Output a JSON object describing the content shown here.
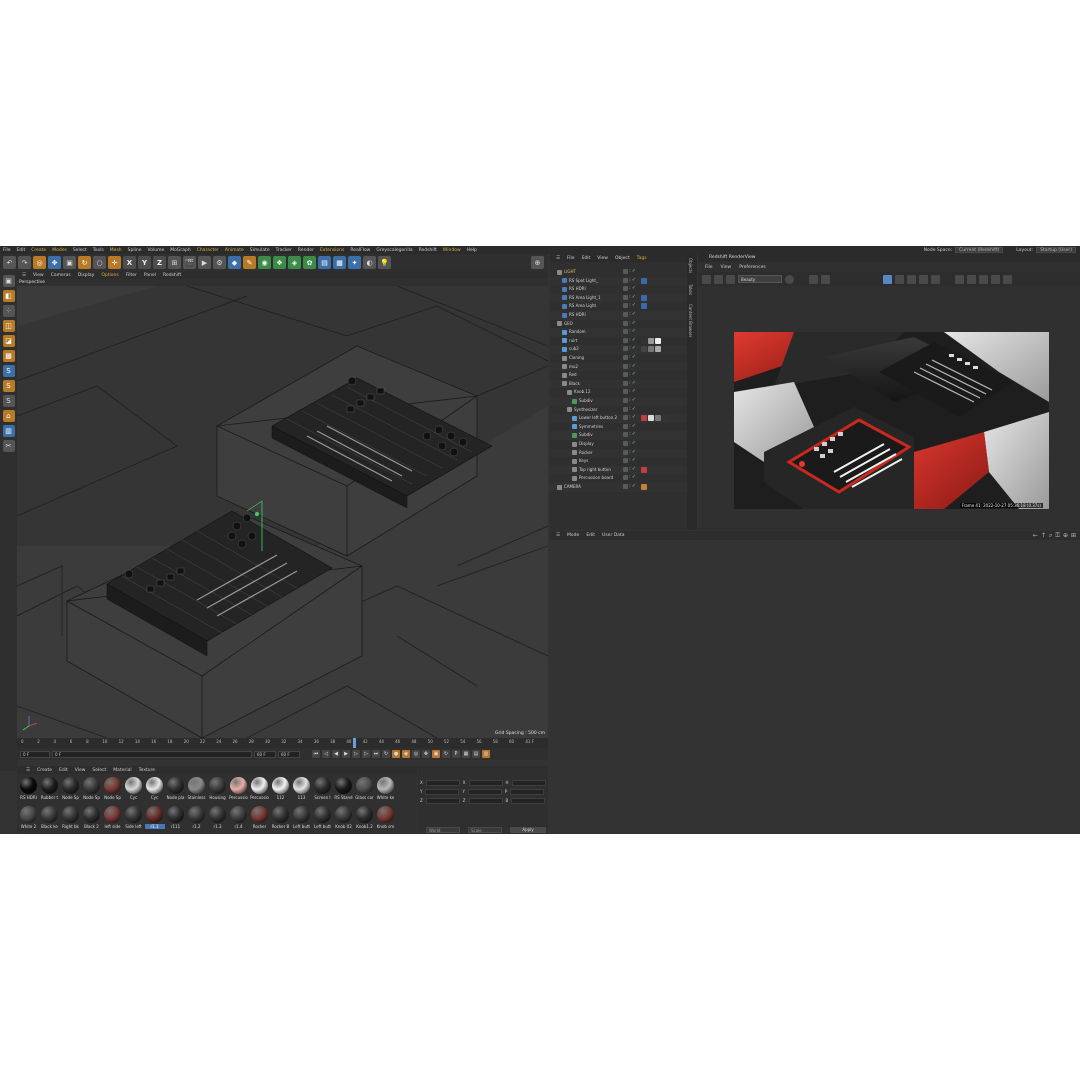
{
  "menubar": {
    "items": [
      {
        "label": "File",
        "hl": false
      },
      {
        "label": "Edit",
        "hl": false
      },
      {
        "label": "Create",
        "hl": true
      },
      {
        "label": "Modes",
        "hl": true
      },
      {
        "label": "Select",
        "hl": false
      },
      {
        "label": "Tools",
        "hl": false
      },
      {
        "label": "Mesh",
        "hl": true
      },
      {
        "label": "Spline",
        "hl": false
      },
      {
        "label": "Volume",
        "hl": false
      },
      {
        "label": "MoGraph",
        "hl": false
      },
      {
        "label": "Character",
        "hl": true
      },
      {
        "label": "Animate",
        "hl": true
      },
      {
        "label": "Simulate",
        "hl": false
      },
      {
        "label": "Tracker",
        "hl": false
      },
      {
        "label": "Render",
        "hl": false
      },
      {
        "label": "Extensions",
        "hl": true
      },
      {
        "label": "RealFlow",
        "hl": false
      },
      {
        "label": "Greyscalegorilla",
        "hl": false
      },
      {
        "label": "Redshift",
        "hl": false
      },
      {
        "label": "Window",
        "hl": true
      },
      {
        "label": "Help",
        "hl": false
      }
    ],
    "node_space_label": "Node Space:",
    "node_space_value": "Current (Redshift)",
    "layout_label": "Layout:",
    "layout_value": "Startup (User)"
  },
  "toolbar": {
    "axis_x": "X",
    "axis_y": "Y",
    "axis_z": "Z"
  },
  "viewport": {
    "menu": [
      {
        "label": "View",
        "sel": false
      },
      {
        "label": "Cameras",
        "sel": false
      },
      {
        "label": "Display",
        "sel": false
      },
      {
        "label": "Options",
        "sel": true
      },
      {
        "label": "Filter",
        "sel": false
      },
      {
        "label": "Panel",
        "sel": false
      },
      {
        "label": "Redshift",
        "sel": false
      }
    ],
    "camera_label": "Perspective",
    "grid_spacing": "Grid Spacing : 500 cm"
  },
  "timeline": {
    "ticks": [
      "0",
      "2",
      "4",
      "6",
      "8",
      "10",
      "12",
      "14",
      "16",
      "18",
      "20",
      "22",
      "24",
      "26",
      "28",
      "30",
      "32",
      "34",
      "36",
      "38",
      "40",
      "42",
      "44",
      "46",
      "48",
      "50",
      "52",
      "54",
      "56",
      "58",
      "60"
    ],
    "current_frame": "41 F",
    "playhead_frame": 41,
    "start_field": "0 F",
    "min_field": "0 F",
    "max_field": "60 F",
    "end_field": "60 F"
  },
  "material_manager": {
    "menu": [
      "Create",
      "Edit",
      "View",
      "Select",
      "Material",
      "Texture"
    ],
    "materials": [
      {
        "label": "RS HDRI",
        "color": "#0a0a0a",
        "sel": false
      },
      {
        "label": "Rubber t",
        "color": "#1e1e1e",
        "sel": false
      },
      {
        "label": "Node Sp",
        "color": "#2a2a2a",
        "sel": false
      },
      {
        "label": "Node Sp",
        "color": "#3a3a3a",
        "sel": false
      },
      {
        "label": "Node Sp",
        "color": "#7a3a32",
        "sel": false
      },
      {
        "label": "Cyc",
        "color": "#d8d8d8",
        "sel": false
      },
      {
        "label": "Cyc",
        "color": "#e8e8e8",
        "sel": false
      },
      {
        "label": "Node pla",
        "color": "#303030",
        "sel": false
      },
      {
        "label": "Stainless",
        "color": "#8a8a8a",
        "sel": false
      },
      {
        "label": "Housing",
        "color": "#3c3c3c",
        "sel": false
      },
      {
        "label": "Percussio",
        "color": "#e8b0a8",
        "sel": false
      },
      {
        "label": "Percussio",
        "color": "#f0f0f0",
        "sel": false
      },
      {
        "label": "112",
        "color": "#f4f4f4",
        "sel": false
      },
      {
        "label": "113",
        "color": "#e4e4e4",
        "sel": false
      },
      {
        "label": "Screen I",
        "color": "#2c2c2c",
        "sel": false
      },
      {
        "label": "RS Stand",
        "color": "#1a1a1a",
        "sel": false
      },
      {
        "label": "Glass cor",
        "color": "#505050",
        "sel": false
      },
      {
        "label": "White ke",
        "color": "#b8b8b8",
        "sel": false
      },
      {
        "label": "White 2",
        "color": "#4a4a4a",
        "sel": false
      },
      {
        "label": "Black ke",
        "color": "#3a3a3a",
        "sel": false
      },
      {
        "label": "Right bk",
        "color": "#363636",
        "sel": false
      },
      {
        "label": "Black 2",
        "color": "#303030",
        "sel": false
      },
      {
        "label": "left side",
        "color": "#7a3a32",
        "sel": false
      },
      {
        "label": "Side left",
        "color": "#343434",
        "sel": false
      },
      {
        "label": "r1.1",
        "color": "#6a2e2a",
        "sel": true
      },
      {
        "label": "r111",
        "color": "#2e2e2e",
        "sel": false
      },
      {
        "label": "r1.2",
        "color": "#3a3a3a",
        "sel": false
      },
      {
        "label": "r1.3",
        "color": "#343434",
        "sel": false
      },
      {
        "label": "r1.4",
        "color": "#3e3e3e",
        "sel": false
      },
      {
        "label": "Rocker",
        "color": "#7a3a32",
        "sel": false
      },
      {
        "label": "Rocker B",
        "color": "#333333",
        "sel": false
      },
      {
        "label": "Left butt",
        "color": "#3a3a3a",
        "sel": false
      },
      {
        "label": "Left butt",
        "color": "#333333",
        "sel": false
      },
      {
        "label": "Knob 02",
        "color": "#3a3a3a",
        "sel": false
      },
      {
        "label": "Knob1.2",
        "color": "#2e2e2e",
        "sel": false
      },
      {
        "label": "Knob sm",
        "color": "#7a3a32",
        "sel": false
      }
    ]
  },
  "coordinates": {
    "rows": [
      {
        "a": "X",
        "b": "X",
        "c": "H"
      },
      {
        "a": "Y",
        "b": "Y",
        "c": "P"
      },
      {
        "a": "Z",
        "b": "Z",
        "c": "B"
      }
    ],
    "dd1": "World",
    "dd2": "Scale",
    "apply": "Apply"
  },
  "object_manager": {
    "menu": [
      {
        "label": "File",
        "sel": false
      },
      {
        "label": "Edit",
        "sel": false
      },
      {
        "label": "View",
        "sel": false
      },
      {
        "label": "Object",
        "sel": false
      },
      {
        "label": "Tags",
        "sel": true
      }
    ],
    "objects": [
      {
        "name": "LIGHT",
        "indent": 0,
        "color": "#8a8a8a",
        "tags": [],
        "name_color": "#e8c060"
      },
      {
        "name": "RS Spot Light_",
        "indent": 1,
        "color": "#4a7ab8",
        "tags": [
          "#3a6aa8"
        ],
        "name_color": ""
      },
      {
        "name": "RS HDRI",
        "indent": 1,
        "color": "#4a7ab8",
        "tags": [],
        "name_color": ""
      },
      {
        "name": "RS Area Light_1",
        "indent": 1,
        "color": "#4a7ab8",
        "tags": [
          "#3a6aa8"
        ],
        "name_color": ""
      },
      {
        "name": "RS Area Light",
        "indent": 1,
        "color": "#4a7ab8",
        "tags": [
          "#3a6aa8"
        ],
        "name_color": ""
      },
      {
        "name": "RS HDRI",
        "indent": 1,
        "color": "#4a7ab8",
        "tags": [],
        "name_color": ""
      },
      {
        "name": "GEO",
        "indent": 0,
        "color": "#8a8a8a",
        "tags": [],
        "name_color": ""
      },
      {
        "name": "Random",
        "indent": 1,
        "color": "#5a9ad8",
        "tags": [],
        "name_color": ""
      },
      {
        "name": "ruirt",
        "indent": 1,
        "color": "#5a9ad8",
        "tags": [
          "#333",
          "#999",
          "#eee"
        ],
        "name_color": ""
      },
      {
        "name": "cub2",
        "indent": 1,
        "color": "#5a9ad8",
        "tags": [
          "#444",
          "#777",
          "#aaa"
        ],
        "name_color": ""
      },
      {
        "name": "Cloning",
        "indent": 1,
        "color": "#8a8a8a",
        "tags": [],
        "name_color": ""
      },
      {
        "name": "mu2",
        "indent": 1,
        "color": "#8a8a8a",
        "tags": [],
        "name_color": ""
      },
      {
        "name": "Red",
        "indent": 1,
        "color": "#8a8a8a",
        "tags": [],
        "name_color": ""
      },
      {
        "name": "Black",
        "indent": 1,
        "color": "#8a8a8a",
        "tags": [],
        "name_color": ""
      },
      {
        "name": "Knob.12",
        "indent": 2,
        "color": "#8a8a8a",
        "tags": [],
        "name_color": ""
      },
      {
        "name": "Subdiv",
        "indent": 3,
        "color": "#4a9a5a",
        "tags": [],
        "name_color": ""
      },
      {
        "name": "Synthesizer",
        "indent": 2,
        "color": "#8a8a8a",
        "tags": [],
        "name_color": ""
      },
      {
        "name": "Lower left button.2",
        "indent": 3,
        "color": "#5a9ad8",
        "tags": [
          "#c04040",
          "#ddd",
          "#777",
          "#333"
        ],
        "name_color": ""
      },
      {
        "name": "Symmetries",
        "indent": 3,
        "color": "#5a9ad8",
        "tags": [],
        "name_color": ""
      },
      {
        "name": "Subdiv",
        "indent": 3,
        "color": "#4a9a5a",
        "tags": [],
        "name_color": ""
      },
      {
        "name": "Display",
        "indent": 3,
        "color": "#8a8a8a",
        "tags": [],
        "name_color": ""
      },
      {
        "name": "Rocker",
        "indent": 3,
        "color": "#8a8a8a",
        "tags": [],
        "name_color": ""
      },
      {
        "name": "Keys",
        "indent": 3,
        "color": "#8a8a8a",
        "tags": [],
        "name_color": ""
      },
      {
        "name": "Top right button",
        "indent": 3,
        "color": "#8a8a8a",
        "tags": [
          "#c04040"
        ],
        "name_color": ""
      },
      {
        "name": "Percussion board",
        "indent": 3,
        "color": "#8a8a8a",
        "tags": [],
        "name_color": ""
      },
      {
        "name": "CAMERA",
        "indent": 0,
        "color": "#8a8a8a",
        "tags": [
          "#c08030"
        ],
        "name_color": ""
      }
    ]
  },
  "side_tabs": [
    "Objects",
    "Takes",
    "Content Browser"
  ],
  "render_view": {
    "title": "Redshift RenderView",
    "menu": [
      "File",
      "View",
      "Preferences"
    ],
    "aov_value": "Beauty",
    "frame_info": "Frame  41: 2022-10-27  05:36:18  (0.37s)"
  },
  "attribute_manager": {
    "menu": [
      "Mode",
      "Edit",
      "User Data"
    ]
  }
}
